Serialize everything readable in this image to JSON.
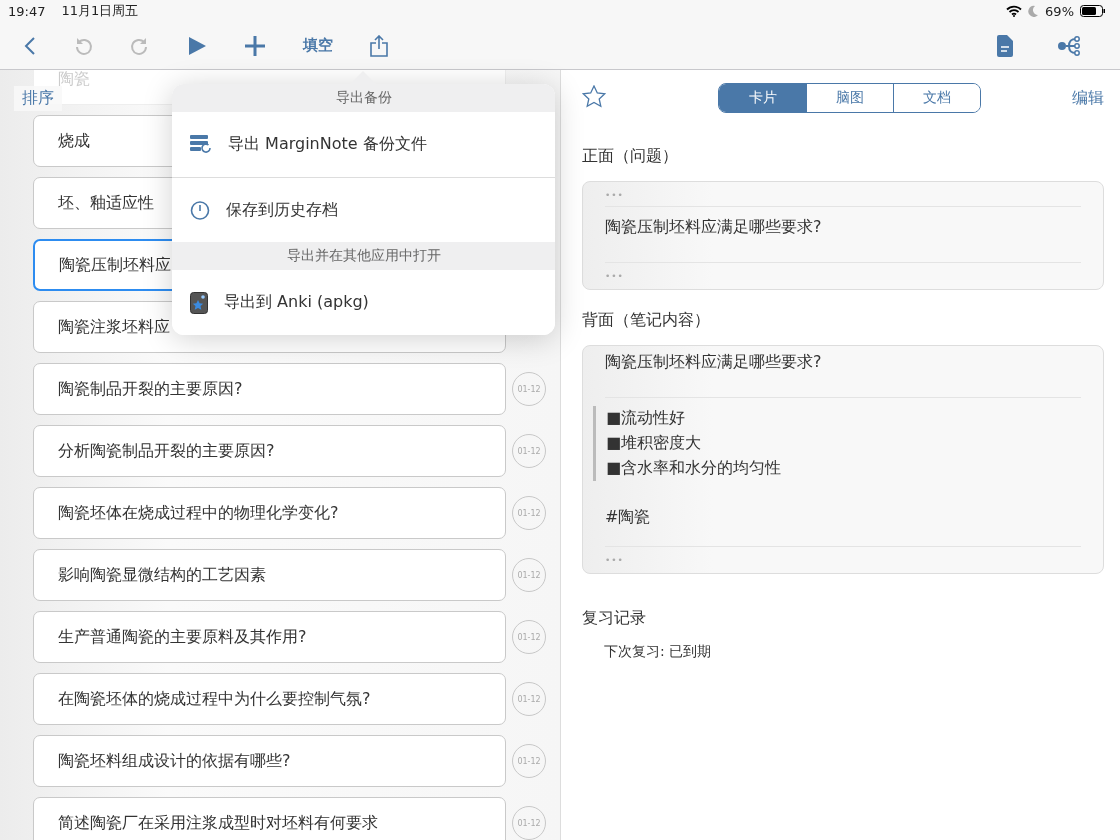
{
  "status_bar": {
    "time": "19:47",
    "date": "11月1日周五",
    "battery_text": "69%"
  },
  "toolbar": {
    "fill_blank": "填空"
  },
  "left_panel": {
    "sort": "排序",
    "cards": [
      {
        "text": "陶瓷",
        "faded": true,
        "selected": false
      },
      {
        "text": "烧成",
        "faded": false,
        "selected": false
      },
      {
        "text": "坯、釉适应性",
        "faded": false,
        "selected": false
      },
      {
        "text": "陶瓷压制坯料应",
        "faded": false,
        "selected": true
      },
      {
        "text": "陶瓷注浆坯料应",
        "faded": false,
        "selected": false
      },
      {
        "text": "陶瓷制品开裂的主要原因?",
        "badge": "01-12",
        "faded": false,
        "selected": false
      },
      {
        "text": "分析陶瓷制品开裂的主要原因?",
        "badge": "01-12",
        "faded": false,
        "selected": false
      },
      {
        "text": "陶瓷坯体在烧成过程中的物理化学变化?",
        "badge": "01-12",
        "faded": false,
        "selected": false
      },
      {
        "text": "影响陶瓷显微结构的工艺因素",
        "badge": "01-12",
        "faded": false,
        "selected": false
      },
      {
        "text": "生产普通陶瓷的主要原料及其作用?",
        "badge": "01-12",
        "faded": false,
        "selected": false
      },
      {
        "text": "在陶瓷坯体的烧成过程中为什么要控制气氛?",
        "badge": "01-12",
        "faded": false,
        "selected": false
      },
      {
        "text": "陶瓷坯料组成设计的依据有哪些?",
        "badge": "01-12",
        "faded": false,
        "selected": false
      },
      {
        "text": "简述陶瓷厂在采用注浆成型时对坯料有何要求",
        "badge": "01-12",
        "faded": false,
        "selected": false
      }
    ]
  },
  "popover": {
    "sections": [
      {
        "header": "导出备份",
        "items": [
          {
            "kind": "backup",
            "label": "导出 MarginNote 备份文件"
          },
          {
            "kind": "history",
            "label": "保存到历史存档"
          }
        ]
      },
      {
        "header": "导出并在其他应用中打开",
        "items": [
          {
            "kind": "anki",
            "label": "导出到 Anki (apkg)"
          }
        ]
      }
    ]
  },
  "right_panel": {
    "tabs": [
      {
        "label": "卡片",
        "selected": true
      },
      {
        "label": "脑图",
        "selected": false
      },
      {
        "label": "文档",
        "selected": false
      }
    ],
    "edit": "编辑",
    "front_title": "正面（问题）",
    "front_dots_top": "•••",
    "front_text": "陶瓷压制坯料应满足哪些要求?",
    "front_dots_bottom": "•••",
    "back_title": "背面（笔记内容）",
    "back_text": "陶瓷压制坯料应满足哪些要求?",
    "back_points": [
      "■流动性好",
      "■堆积密度大",
      "■含水率和水分的均匀性"
    ],
    "tag": "#陶瓷",
    "back_dots": "•••",
    "review_title": "复习记录",
    "review_text": "下次复习: 已到期"
  }
}
